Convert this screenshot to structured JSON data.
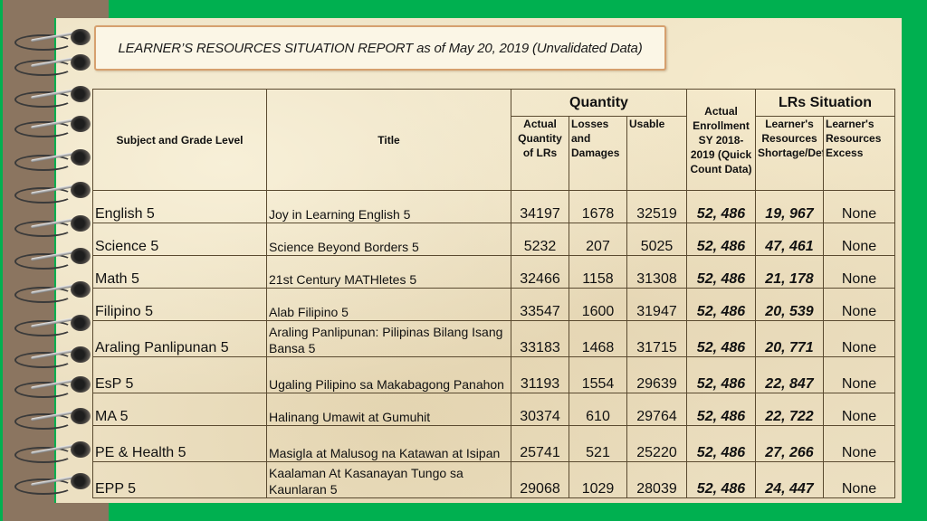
{
  "title": "LEARNER’S RESOURCES SITUATION REPORT as of May 20, 2019 (Unvalidated Data)",
  "colors": {
    "background_green": "#00b050",
    "binding_brown": "#8b7560",
    "highlight_purple": "#7030a0",
    "banner_border": "#d6a06e"
  },
  "table": {
    "headers": {
      "subject": "Subject and Grade Level",
      "title": "Title",
      "quantity_group": "Quantity",
      "actual_quantity": "Actual Quantity of LRs",
      "losses": "Losses and Damages",
      "usable": "Usable",
      "enrollment": "Actual Enrollment SY 2018-2019 (Quick Count Data)",
      "situation_group": "LRs Situation",
      "shortage": "Learner's Resources Shortage/Deficiency",
      "excess": "Learner's Resources Excess"
    },
    "rows": [
      {
        "subject": "English 5",
        "title": "Joy in Learning English 5",
        "actual": "34197",
        "losses": "1678",
        "usable": "32519",
        "enrollment": "52, 486",
        "shortage": "19, 967",
        "excess": "None"
      },
      {
        "subject": "Science 5",
        "title": "Science Beyond Borders 5",
        "actual": "5232",
        "losses": "207",
        "usable": "5025",
        "enrollment": "52, 486",
        "shortage": "47, 461",
        "excess": "None"
      },
      {
        "subject": "Math 5",
        "title": "21st Century MATHletes 5",
        "actual": "32466",
        "losses": "1158",
        "usable": "31308",
        "enrollment": "52, 486",
        "shortage": "21, 178",
        "excess": "None"
      },
      {
        "subject": "Filipino 5",
        "title": "Alab Filipino 5",
        "actual": "33547",
        "losses": "1600",
        "usable": "31947",
        "enrollment": "52, 486",
        "shortage": "20, 539",
        "excess": "None"
      },
      {
        "subject": "Araling Panlipunan 5",
        "title": "Araling Panlipunan: Pilipinas Bilang Isang Bansa 5",
        "actual": "33183",
        "losses": "1468",
        "usable": "31715",
        "enrollment": "52, 486",
        "shortage": "20, 771",
        "excess": "None"
      },
      {
        "subject": "EsP 5",
        "title": "Ugaling Pilipino sa Makabagong Panahon",
        "actual": "31193",
        "losses": "1554",
        "usable": "29639",
        "enrollment": "52, 486",
        "shortage": "22, 847",
        "excess": "None"
      },
      {
        "subject": "MA 5",
        "title": "Halinang Umawit at Gumuhit",
        "actual": "30374",
        "losses": "610",
        "usable": "29764",
        "enrollment": "52, 486",
        "shortage": "22, 722",
        "excess": "None"
      },
      {
        "subject": "PE & Health 5",
        "title": "Masigla at Malusog na Katawan at Isipan",
        "actual": "25741",
        "losses": "521",
        "usable": "25220",
        "enrollment": "52, 486",
        "shortage": "27, 266",
        "excess": "None"
      },
      {
        "subject": "EPP 5",
        "title": "Kaalaman At Kasanayan Tungo sa Kaunlaran 5",
        "actual": "29068",
        "losses": "1029",
        "usable": "28039",
        "enrollment": "52, 486",
        "shortage": "24, 447",
        "excess": "None"
      }
    ]
  }
}
